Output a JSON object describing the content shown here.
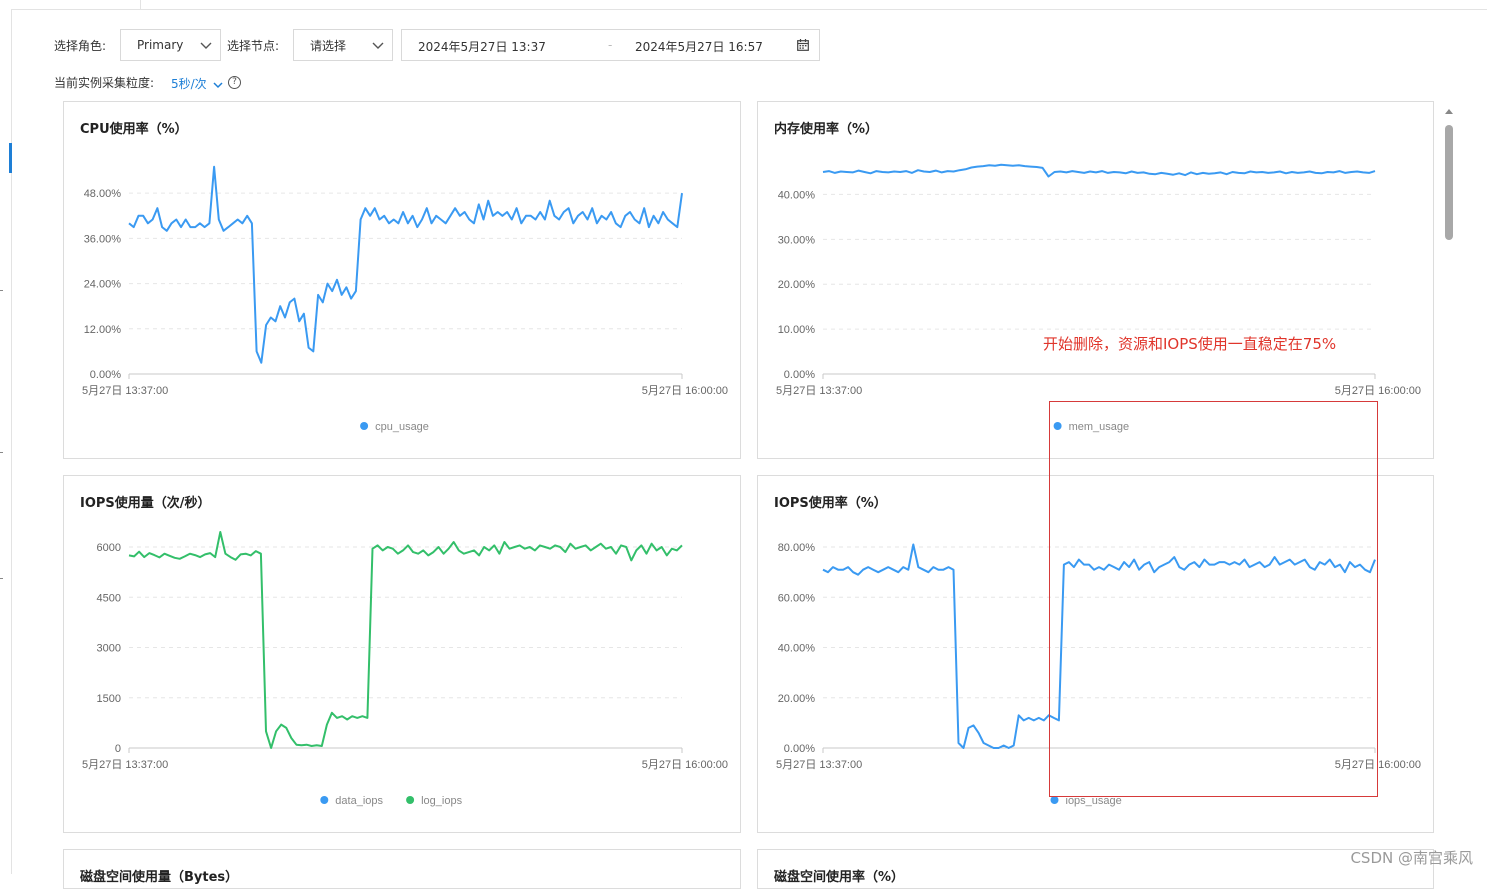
{
  "filters": {
    "role_label": "选择角色:",
    "role_value": "Primary",
    "node_label": "选择节点:",
    "node_value": "请选择",
    "date_start": "2024年5月27日 13:37",
    "date_sep": "-",
    "date_end": "2024年5月27日 16:57",
    "granularity_label": "当前实例采集粒度:",
    "granularity_value": "5秒/次",
    "help_glyph": "?"
  },
  "annotation": "开始删除，资源和IOPS使用一直稳定在75%",
  "watermark": "CSDN @南宫乘风",
  "cards": {
    "cpu": {
      "title": "CPU使用率（%）"
    },
    "mem": {
      "title": "内存使用率（%）"
    },
    "iops_count": {
      "title": "IOPS使用量（次/秒）"
    },
    "iops_rate": {
      "title": "IOPS使用率（%）"
    },
    "disk_usage": {
      "title": "磁盘空间使用量（Bytes）"
    },
    "disk_rate": {
      "title": "磁盘空间使用率（%）"
    }
  },
  "colors": {
    "blue": "#3a9af2",
    "green": "#33bf6a",
    "accent": "#1e7fd6",
    "annotation": "#e0352b"
  },
  "chart_data": [
    {
      "id": "cpu",
      "type": "line",
      "title": "CPU使用率（%）",
      "xlabels": [
        "5月27日 13:37:00",
        "5月27日 16:00:00"
      ],
      "yticks": [
        "0.00%",
        "12.00%",
        "24.00%",
        "36.00%",
        "48.00%"
      ],
      "ylim": [
        0,
        56
      ],
      "grid": true,
      "legend_position": "bottom",
      "series": [
        {
          "name": "cpu_usage",
          "color": "#3a9af2",
          "values": [
            40,
            39,
            42,
            42,
            40,
            41,
            44,
            39,
            38,
            40,
            41,
            39,
            41,
            39,
            39,
            40,
            39,
            40,
            55,
            41,
            38,
            39,
            40,
            41,
            40,
            42,
            40,
            6,
            3,
            13,
            15,
            14,
            18,
            15,
            19,
            20,
            14,
            16,
            7,
            6,
            21,
            19,
            24,
            22,
            25,
            21,
            23,
            20,
            22,
            41,
            44,
            42,
            44,
            41,
            42,
            40,
            41,
            40,
            43,
            40,
            42,
            39,
            41,
            44,
            40,
            42,
            41,
            40,
            42,
            44,
            42,
            43,
            41,
            40,
            45,
            41,
            46,
            42,
            43,
            42,
            43,
            41,
            44,
            40,
            42,
            42,
            41,
            43,
            41,
            46,
            42,
            41,
            43,
            44,
            40,
            42,
            43,
            41,
            44,
            40,
            42,
            41,
            43,
            40,
            39,
            42,
            43,
            41,
            40,
            44,
            39,
            42,
            40,
            43,
            41,
            40,
            39,
            48
          ]
        }
      ]
    },
    {
      "id": "mem",
      "type": "line",
      "title": "内存使用率（%）",
      "xlabels": [
        "5月27日 13:37:00",
        "5月27日 16:00:00"
      ],
      "yticks": [
        "0.00%",
        "10.00%",
        "20.00%",
        "30.00%",
        "40.00%"
      ],
      "ylim": [
        0,
        47
      ],
      "grid": true,
      "legend_position": "bottom",
      "series": [
        {
          "name": "mem_usage",
          "color": "#3a9af2",
          "values": [
            45,
            45.2,
            44.8,
            45.1,
            45,
            44.9,
            45.3,
            45,
            44.7,
            45.2,
            45,
            44.9,
            45.1,
            45,
            45.2,
            44.8,
            45.4,
            45.1,
            45,
            45.3,
            44.9,
            45.2,
            45.1,
            45.4,
            45.6,
            46,
            46.2,
            46.3,
            46.5,
            46.4,
            46.6,
            46.5,
            46.4,
            46.5,
            46.3,
            46.2,
            46.1,
            45.9,
            44,
            45,
            45.1,
            44.9,
            45.2,
            45,
            44.8,
            45.1,
            44.9,
            45.2,
            44.8,
            45,
            44.9,
            44.7,
            45.1,
            44.8,
            44.9,
            44.6,
            44.5,
            44.8,
            44.6,
            44.4,
            44.7,
            44.3,
            44.9,
            44.5,
            44.8,
            44.6,
            44.7,
            44.9,
            44.5,
            45,
            44.8,
            44.7,
            45.1,
            44.9,
            45,
            44.8,
            44.9,
            45.1,
            44.7,
            45,
            44.8,
            44.9,
            45.1,
            44.8,
            44.7,
            45,
            44.9,
            45.2,
            44.8,
            45,
            45.1,
            44.9,
            44.8,
            45.2
          ]
        }
      ]
    },
    {
      "id": "iops_count",
      "type": "line",
      "title": "IOPS使用量（次/秒）",
      "xlabels": [
        "5月27日 13:37:00",
        "5月27日 16:00:00"
      ],
      "yticks": [
        "0",
        "1500",
        "3000",
        "4500",
        "6000"
      ],
      "ylim": [
        0,
        6300
      ],
      "grid": true,
      "legend_position": "bottom",
      "series": [
        {
          "name": "data_iops",
          "color": "#3a9af2",
          "values": []
        },
        {
          "name": "log_iops",
          "color": "#33bf6a",
          "values": [
            5750,
            5720,
            5860,
            5700,
            5820,
            5760,
            5690,
            5800,
            5740,
            5680,
            5650,
            5720,
            5800,
            5760,
            5700,
            5780,
            5820,
            5700,
            6450,
            5800,
            5700,
            5620,
            5780,
            5800,
            5750,
            5880,
            5800,
            500,
            0,
            500,
            700,
            600,
            300,
            100,
            80,
            100,
            60,
            80,
            60,
            700,
            1050,
            900,
            950,
            850,
            950,
            900,
            950,
            900,
            5950,
            6050,
            5900,
            6000,
            5950,
            5800,
            5900,
            6050,
            5850,
            5800,
            5900,
            5750,
            5850,
            6000,
            5800,
            5950,
            6150,
            5900,
            5800,
            5850,
            5900,
            5750,
            6000,
            5900,
            6050,
            5800,
            6150,
            5950,
            6000,
            6050,
            5950,
            6000,
            5900,
            6050,
            6000,
            5950,
            6050,
            6000,
            5850,
            6100,
            5950,
            6000,
            6050,
            5900,
            6000,
            6100,
            5950,
            6000,
            5800,
            6050,
            6000,
            5600,
            5900,
            6050,
            5800,
            6100,
            5900,
            6000,
            5750,
            5950,
            5900,
            6050
          ]
        }
      ]
    },
    {
      "id": "iops_rate",
      "type": "line",
      "title": "IOPS使用率（%）",
      "xlabels": [
        "5月27日 13:37:00",
        "5月27日 16:00:00"
      ],
      "yticks": [
        "0.00%",
        "20.00%",
        "40.00%",
        "60.00%",
        "80.00%"
      ],
      "ylim": [
        0,
        84
      ],
      "grid": true,
      "legend_position": "bottom",
      "series": [
        {
          "name": "iops_usage",
          "color": "#3a9af2",
          "values": [
            71,
            70,
            72,
            71,
            71,
            72,
            70,
            69,
            71,
            72,
            71,
            70,
            71,
            72,
            71,
            70,
            72,
            71,
            81,
            72,
            71,
            70,
            72,
            71,
            71,
            72,
            71,
            2,
            0,
            8,
            9,
            6,
            2,
            1,
            0,
            0,
            1,
            0,
            1,
            13,
            11,
            12,
            11,
            12,
            11,
            13,
            12,
            11,
            73,
            74,
            72,
            75,
            73,
            73,
            71,
            72,
            71,
            73,
            72,
            71,
            74,
            72,
            75,
            71,
            73,
            74,
            70,
            72,
            73,
            74,
            76,
            72,
            71,
            73,
            74,
            72,
            75,
            73,
            73,
            74,
            74,
            73,
            74,
            73,
            75,
            72,
            73,
            74,
            72,
            73,
            76,
            73,
            74,
            75,
            73,
            74,
            75,
            72,
            71,
            74,
            73,
            75,
            72,
            73,
            70,
            74,
            72,
            73,
            71,
            70,
            75
          ]
        }
      ]
    },
    {
      "id": "disk_usage",
      "type": "line",
      "title": "磁盘空间使用量（Bytes）",
      "series": []
    },
    {
      "id": "disk_rate",
      "type": "line",
      "title": "磁盘空间使用率（%）",
      "series": []
    }
  ]
}
